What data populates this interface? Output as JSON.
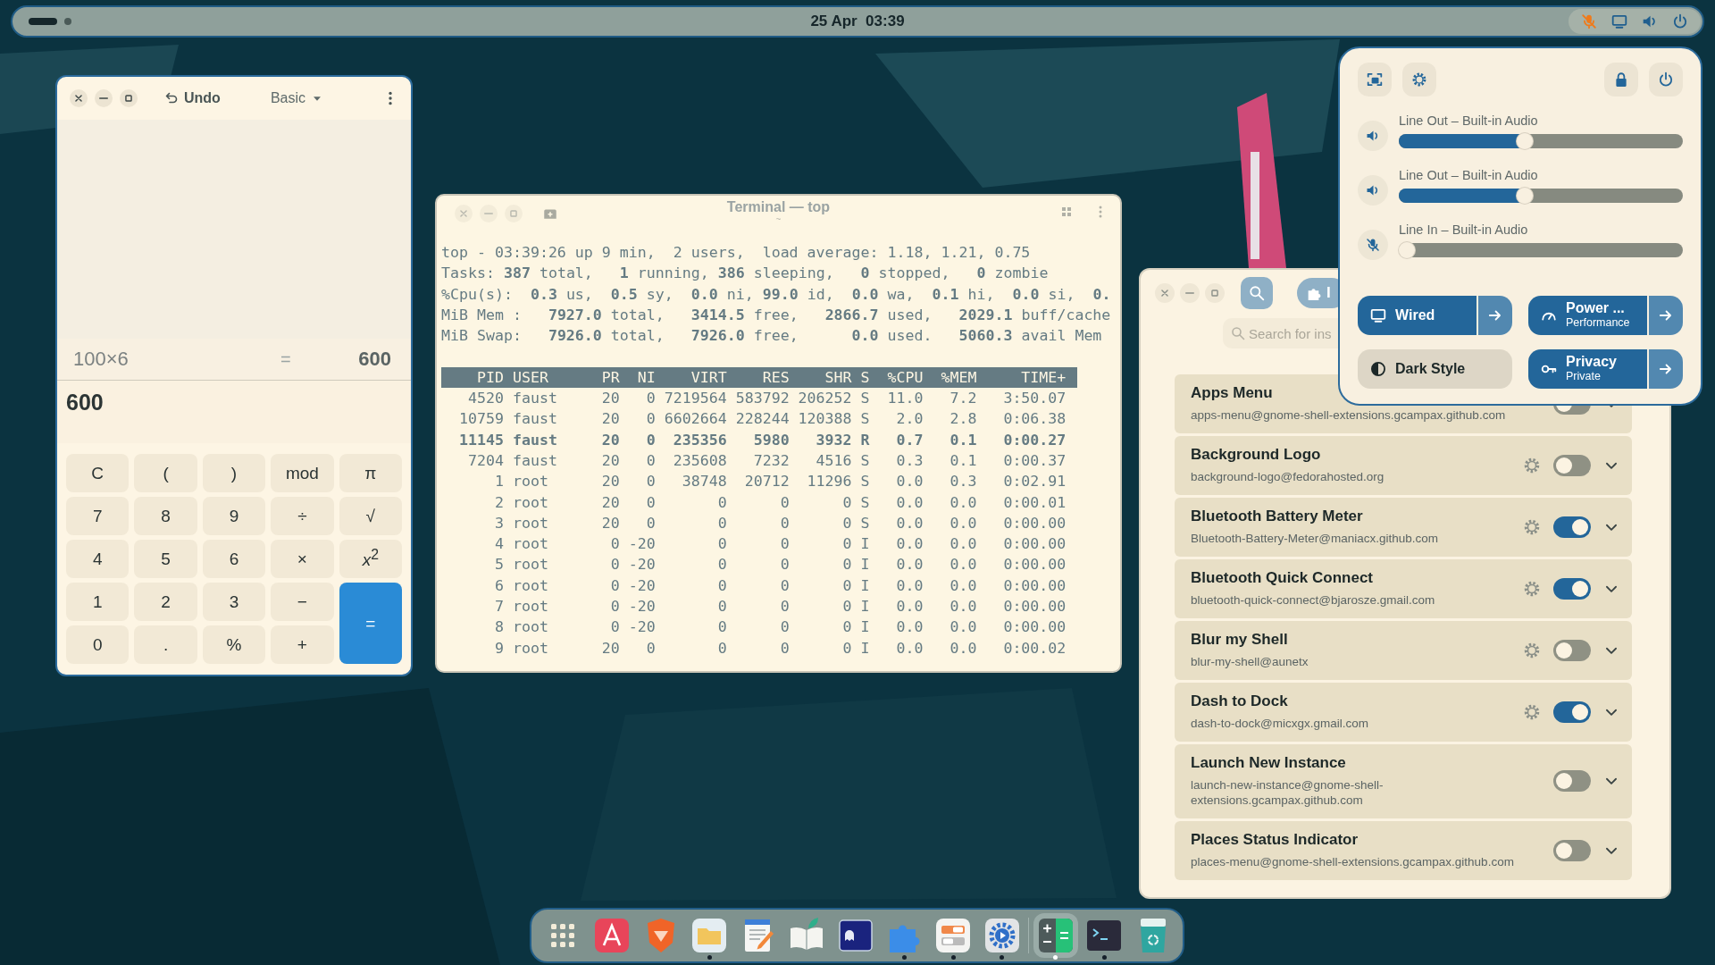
{
  "top_bar": {
    "workspaces": [
      {
        "selected": true
      },
      {
        "selected": false
      }
    ],
    "clock": "25 Apr  03:39",
    "mic_muted": true
  },
  "calculator": {
    "undo": "Undo",
    "mode": "Basic",
    "history": {
      "expression": "100×6",
      "equals": "=",
      "result": "600"
    },
    "display": "600",
    "keys": [
      {
        "label": "C",
        "kind": "key"
      },
      {
        "label": "(",
        "kind": "key"
      },
      {
        "label": ")",
        "kind": "key"
      },
      {
        "label": "mod",
        "kind": "key"
      },
      {
        "label": "π",
        "kind": "key"
      },
      {
        "label": "7",
        "kind": "key"
      },
      {
        "label": "8",
        "kind": "key"
      },
      {
        "label": "9",
        "kind": "key"
      },
      {
        "label": "÷",
        "kind": "key"
      },
      {
        "label": "√",
        "kind": "key"
      },
      {
        "label": "4",
        "kind": "key"
      },
      {
        "label": "5",
        "kind": "key"
      },
      {
        "label": "6",
        "kind": "key"
      },
      {
        "label": "×",
        "kind": "key"
      },
      {
        "label": "*x*$^{2}$",
        "kind": "key"
      },
      {
        "label": "1",
        "kind": "key"
      },
      {
        "label": "2",
        "kind": "key"
      },
      {
        "label": "3",
        "kind": "key"
      },
      {
        "label": "−",
        "kind": "key"
      },
      {
        "label": "=",
        "kind": "equals"
      },
      {
        "label": "0",
        "kind": "key"
      },
      {
        "label": ".",
        "kind": "key"
      },
      {
        "label": "%",
        "kind": "key"
      },
      {
        "label": "+",
        "kind": "key"
      }
    ]
  },
  "terminal": {
    "title": "Terminal — top",
    "subtitle": "~",
    "summary": [
      "top - 03:39:26 up 9 min,  2 users,  load average: 1.18, 1.21, 0.75",
      "Tasks: **387** total,   **1** running, **386** sleeping,   **0** stopped,   **0** zombie",
      "%Cpu(s):  **0.3** us,  **0.5** sy,  **0.0** ni, **99.0** id,  **0.0** wa,  **0.1** hi,  **0.0** si,  **0.**",
      "MiB Mem :   **7927.0** total,   **3414.5** free,   **2866.7** used,   **2029.1** buff/cache",
      "MiB Swap:   **7926.0** total,   **7926.0** free,      **0.0** used.   **5060.3** avail Mem"
    ],
    "columns": [
      "PID",
      "USER",
      "PR",
      "NI",
      "VIRT",
      "RES",
      "SHR",
      "S",
      "%CPU",
      "%MEM",
      "TIME+"
    ],
    "processes": [
      {
        "cells": [
          "4520",
          "faust",
          "20",
          "0",
          "7219564",
          "583792",
          "206252",
          "S",
          "11.0",
          "7.2",
          "3:50.07"
        ],
        "highlighted": false
      },
      {
        "cells": [
          "10759",
          "faust",
          "20",
          "0",
          "6602664",
          "228244",
          "120388",
          "S",
          "2.0",
          "2.8",
          "0:06.38"
        ],
        "highlighted": false
      },
      {
        "cells": [
          "11145",
          "faust",
          "20",
          "0",
          "235356",
          "5980",
          "3932",
          "R",
          "0.7",
          "0.1",
          "0:00.27"
        ],
        "highlighted": true
      },
      {
        "cells": [
          "7204",
          "faust",
          "20",
          "0",
          "235608",
          "7232",
          "4516",
          "S",
          "0.3",
          "0.1",
          "0:00.37"
        ],
        "highlighted": false
      },
      {
        "cells": [
          "1",
          "root",
          "20",
          "0",
          "38748",
          "20712",
          "11296",
          "S",
          "0.0",
          "0.3",
          "0:02.91"
        ],
        "highlighted": false
      },
      {
        "cells": [
          "2",
          "root",
          "20",
          "0",
          "0",
          "0",
          "0",
          "S",
          "0.0",
          "0.0",
          "0:00.01"
        ],
        "highlighted": false
      },
      {
        "cells": [
          "3",
          "root",
          "20",
          "0",
          "0",
          "0",
          "0",
          "S",
          "0.0",
          "0.0",
          "0:00.00"
        ],
        "highlighted": false
      },
      {
        "cells": [
          "4",
          "root",
          "0",
          "-20",
          "0",
          "0",
          "0",
          "I",
          "0.0",
          "0.0",
          "0:00.00"
        ],
        "highlighted": false
      },
      {
        "cells": [
          "5",
          "root",
          "0",
          "-20",
          "0",
          "0",
          "0",
          "I",
          "0.0",
          "0.0",
          "0:00.00"
        ],
        "highlighted": false
      },
      {
        "cells": [
          "6",
          "root",
          "0",
          "-20",
          "0",
          "0",
          "0",
          "I",
          "0.0",
          "0.0",
          "0:00.00"
        ],
        "highlighted": false
      },
      {
        "cells": [
          "7",
          "root",
          "0",
          "-20",
          "0",
          "0",
          "0",
          "I",
          "0.0",
          "0.0",
          "0:00.00"
        ],
        "highlighted": false
      },
      {
        "cells": [
          "8",
          "root",
          "0",
          "-20",
          "0",
          "0",
          "0",
          "I",
          "0.0",
          "0.0",
          "0:00.00"
        ],
        "highlighted": false
      },
      {
        "cells": [
          "9",
          "root",
          "20",
          "0",
          "0",
          "0",
          "0",
          "I",
          "0.0",
          "0.0",
          "0:00.02"
        ],
        "highlighted": false
      }
    ]
  },
  "extensions": {
    "tab": {
      "label": "I",
      "selected": true
    },
    "search": {
      "placeholder": "Search for ins"
    },
    "items": [
      {
        "name": "Apps Menu",
        "id": "apps-menu@gnome-shell-extensions.gcampax.github.com",
        "has_settings": false,
        "enabled": false
      },
      {
        "name": "Background Logo",
        "id": "background-logo@fedorahosted.org",
        "has_settings": true,
        "enabled": false
      },
      {
        "name": "Bluetooth Battery Meter",
        "id": "Bluetooth-Battery-Meter@maniacx.github.com",
        "has_settings": true,
        "enabled": true
      },
      {
        "name": "Bluetooth Quick Connect",
        "id": "bluetooth-quick-connect@bjarosze.gmail.com",
        "has_settings": true,
        "enabled": true
      },
      {
        "name": "Blur my Shell",
        "id": "blur-my-shell@aunetx",
        "has_settings": true,
        "enabled": false
      },
      {
        "name": "Dash to Dock",
        "id": "dash-to-dock@micxgx.gmail.com",
        "has_settings": true,
        "enabled": true
      },
      {
        "name": "Launch New Instance",
        "id": "launch-new-instance@gnome-shell-extensions.gcampax.github.com",
        "has_settings": false,
        "enabled": false
      },
      {
        "name": "Places Status Indicator",
        "id": "places-menu@gnome-shell-extensions.gcampax.github.com",
        "has_settings": false,
        "enabled": false
      }
    ]
  },
  "quick_settings": {
    "sliders": [
      {
        "label": "Line Out – Built-in Audio",
        "kind": "speaker",
        "level": 0.44
      },
      {
        "label": "Line Out – Built-in Audio",
        "kind": "speaker",
        "level": 0.44
      },
      {
        "label": "Line In – Built-in Audio",
        "kind": "mic-muted",
        "level": 0.0
      }
    ],
    "toggles": [
      {
        "kind": "network",
        "title": "Wired",
        "on": true,
        "has_menu": true
      },
      {
        "kind": "power-mode",
        "title": "Power ...",
        "subtitle": "Performance",
        "on": true,
        "has_menu": true
      },
      {
        "kind": "dark-style",
        "title": "Dark Style",
        "on": false,
        "has_menu": false
      },
      {
        "kind": "privacy",
        "title": "Privacy",
        "subtitle": "Private",
        "on": true,
        "has_menu": true
      }
    ]
  },
  "dock": {
    "items": [
      {
        "kind": "app-grid",
        "running": false,
        "selected": false
      },
      {
        "kind": "software",
        "running": false,
        "selected": false
      },
      {
        "kind": "browser",
        "running": false,
        "selected": false
      },
      {
        "kind": "files",
        "running": true,
        "selected": false
      },
      {
        "kind": "text-editor",
        "running": false,
        "selected": false
      },
      {
        "kind": "reader",
        "running": false,
        "selected": false
      },
      {
        "kind": "ghost",
        "running": false,
        "selected": false
      },
      {
        "kind": "extensions",
        "running": true,
        "selected": false
      },
      {
        "kind": "tweaks",
        "running": true,
        "selected": false
      },
      {
        "kind": "settings",
        "running": true,
        "selected": false
      },
      {
        "kind": "separator"
      },
      {
        "kind": "calculator",
        "running": true,
        "selected": true
      },
      {
        "kind": "terminal",
        "running": true,
        "selected": false
      },
      {
        "kind": "trash",
        "running": false,
        "selected": false
      }
    ]
  }
}
